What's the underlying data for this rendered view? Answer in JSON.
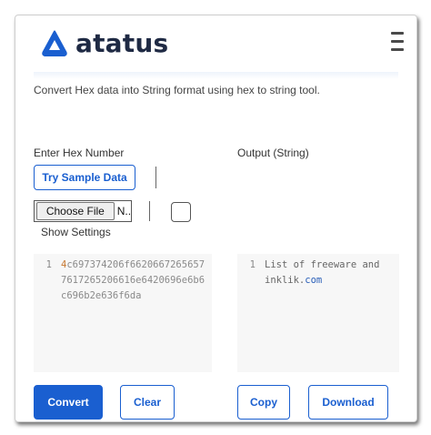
{
  "header": {
    "logo_text": "atatus",
    "logo_color": "#1a5fd0",
    "menu_icon": "hamburger-icon"
  },
  "description": "Convert Hex data into String format using hex to string tool.",
  "input_section": {
    "label": "Enter Hex Number",
    "sample_button": "Try Sample Data",
    "file_button": "Choose File",
    "file_name": "N..",
    "show_settings": "Show Settings",
    "line_number": "1",
    "hex_first_char": "4",
    "hex_rest": "c697374206f66206672656577617265206616e6420696e6b6c696b2e636f6da"
  },
  "output_section": {
    "label": "Output (String)",
    "line_number": "1",
    "text_main": "List of freeware and inklik.",
    "text_link": "com"
  },
  "actions": {
    "convert": "Convert",
    "clear": "Clear",
    "copy": "Copy",
    "download": "Download"
  },
  "colors": {
    "primary": "#1a5fd0",
    "hex_highlight": "#c7772f"
  }
}
